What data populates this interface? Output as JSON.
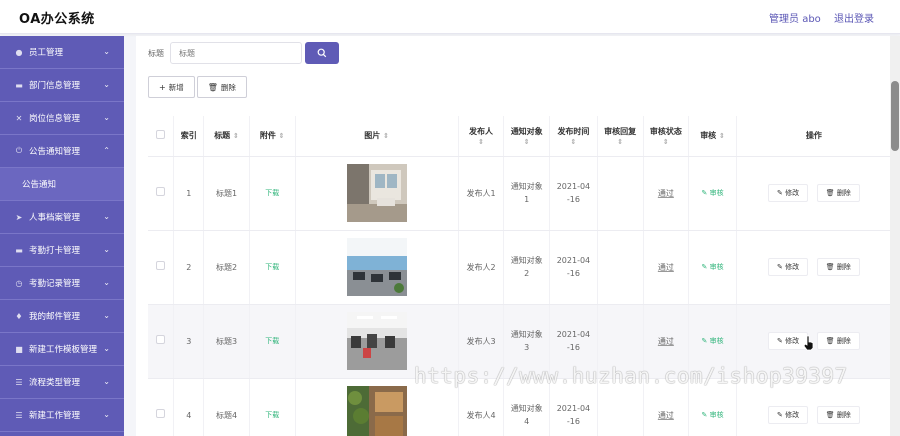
{
  "header": {
    "title": "OA办公系统",
    "user": "管理员 abo",
    "logout": "退出登录"
  },
  "sidebar": {
    "items": [
      {
        "label": "员工管理",
        "icon": "user-icon"
      },
      {
        "label": "部门信息管理",
        "icon": "list-icon"
      },
      {
        "label": "岗位信息管理",
        "icon": "tool-icon"
      },
      {
        "label": "公告通知管理",
        "icon": "power-icon",
        "expanded": true
      },
      {
        "label": "人事档案管理",
        "icon": "send-icon"
      },
      {
        "label": "考勤打卡管理",
        "icon": "list-icon"
      },
      {
        "label": "考勤记录管理",
        "icon": "clock-icon"
      },
      {
        "label": "我的邮件管理",
        "icon": "mic-icon"
      },
      {
        "label": "新建工作模板管理",
        "icon": "doc-icon"
      },
      {
        "label": "流程类型管理",
        "icon": "menu-icon"
      },
      {
        "label": "新建工作管理",
        "icon": "sliders-icon"
      }
    ],
    "sub_item": "公告通知"
  },
  "search": {
    "label": "标题",
    "placeholder": "标题"
  },
  "buttons": {
    "add": "新增",
    "delete": "删除"
  },
  "table": {
    "headers": {
      "index": "索引",
      "title": "标题",
      "attachment": "附件",
      "image": "图片",
      "publisher": "发布人",
      "target": "通知对象",
      "time": "发布时间",
      "reply": "审核回复",
      "status": "审核状态",
      "audit": "审核",
      "ops": "操作"
    },
    "rows": [
      {
        "index": "1",
        "title": "标题1",
        "attachment": "下载",
        "publisher": "发布人1",
        "target_a": "通知对象",
        "target_b": "1",
        "time_a": "2021-04",
        "time_b": "-16",
        "reply": "",
        "status": "通过",
        "audit": "审核",
        "edit": "修改",
        "del": "删除"
      },
      {
        "index": "2",
        "title": "标题2",
        "attachment": "下载",
        "publisher": "发布人2",
        "target_a": "通知对象",
        "target_b": "2",
        "time_a": "2021-04",
        "time_b": "-16",
        "reply": "",
        "status": "通过",
        "audit": "审核",
        "edit": "修改",
        "del": "删除"
      },
      {
        "index": "3",
        "title": "标题3",
        "attachment": "下载",
        "publisher": "发布人3",
        "target_a": "通知对象",
        "target_b": "3",
        "time_a": "2021-04",
        "time_b": "-16",
        "reply": "",
        "status": "通过",
        "audit": "审核",
        "edit": "修改",
        "del": "删除"
      },
      {
        "index": "4",
        "title": "标题4",
        "attachment": "下载",
        "publisher": "发布人4",
        "target_a": "通知对象",
        "target_b": "4",
        "time_a": "2021-04",
        "time_b": "-16",
        "reply": "",
        "status": "通过",
        "audit": "审核",
        "edit": "修改",
        "del": "删除"
      }
    ]
  },
  "watermark": "https://www.huzhan.com/ishop39397",
  "colors": {
    "primary": "#5f5bb6",
    "link": "#2fb47a"
  }
}
